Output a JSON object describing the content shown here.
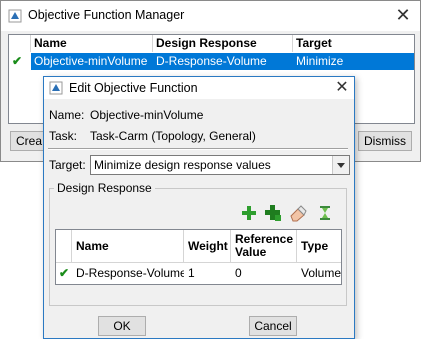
{
  "manager": {
    "title": "Objective Function Manager",
    "columns": [
      "Name",
      "Design Response",
      "Target"
    ],
    "rows": [
      {
        "name": "Objective-minVolume",
        "design_response": "D-Response-Volume",
        "target": "Minimize",
        "selected": true
      }
    ],
    "create_label": "Crea",
    "dismiss_label": "Dismiss"
  },
  "dialog": {
    "title": "Edit Objective Function",
    "name_label": "Name:",
    "name_value": "Objective-minVolume",
    "task_label": "Task:",
    "task_value": "Task-Carm (Topology, General)",
    "target_label": "Target:",
    "target_value": "Minimize design response values",
    "group_label": "Design Response",
    "table": {
      "headers": {
        "name": "Name",
        "weight": "Weight",
        "reference_value": "Reference Value",
        "type": "Type"
      },
      "rows": [
        {
          "name": "D-Response-Volume",
          "weight": "1",
          "reference_value": "0",
          "type": "Volume"
        }
      ]
    },
    "ok_label": "OK",
    "cancel_label": "Cancel"
  },
  "colors": {
    "selection": "#0078d7",
    "check": "#1a8c1a",
    "accent_border": "#2b79c2"
  }
}
